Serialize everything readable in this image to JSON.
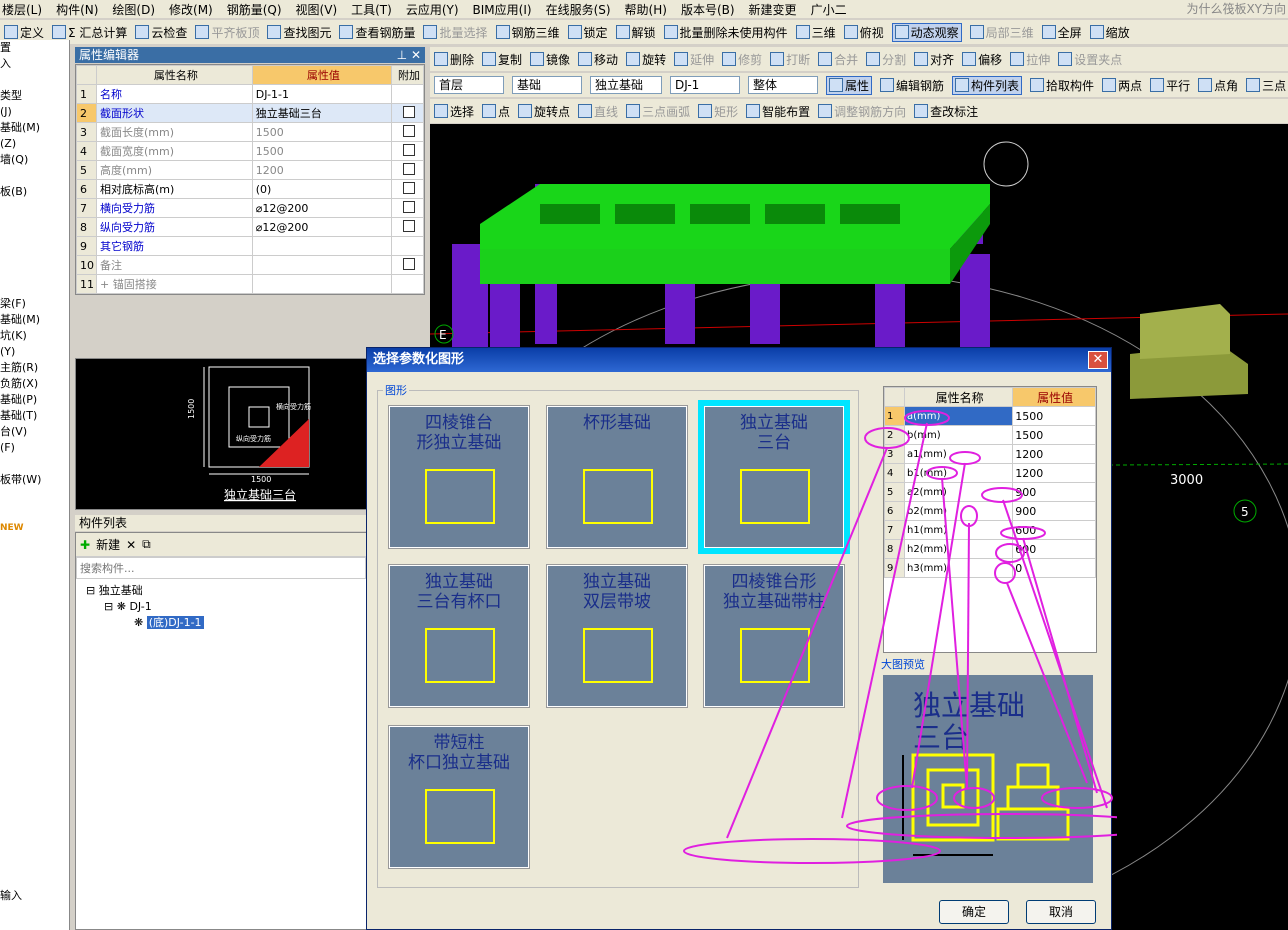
{
  "menu": {
    "items": [
      "楼层(L)",
      "构件(N)",
      "绘图(D)",
      "修改(M)",
      "钢筋量(Q)",
      "视图(V)",
      "工具(T)",
      "云应用(Y)",
      "BIM应用(I)",
      "在线服务(S)",
      "帮助(H)",
      "版本号(B)",
      "新建变更",
      "广小二"
    ],
    "right_text": "为什么筏板XY方向"
  },
  "toolbar1": {
    "items": [
      "定义",
      "Σ 汇总计算",
      "云检查",
      "平齐板顶",
      "查找图元",
      "查看钢筋量",
      "批量选择",
      "钢筋三维",
      "锁定",
      "解锁",
      "批量删除未使用构件",
      "三维",
      "俯视",
      "动态观察",
      "局部三维",
      "全屏",
      "缩放"
    ]
  },
  "toolbar2": {
    "items": [
      "删除",
      "复制",
      "镜像",
      "移动",
      "旋转",
      "延伸",
      "修剪",
      "打断",
      "合并",
      "分割",
      "对齐",
      "偏移",
      "拉伸",
      "设置夹点"
    ]
  },
  "toolbar3": {
    "combos": [
      "首层",
      "基础",
      "独立基础",
      "DJ-1",
      "整体"
    ],
    "buttons": [
      "属性",
      "编辑钢筋",
      "构件列表",
      "拾取构件",
      "两点",
      "平行",
      "点角",
      "三点"
    ]
  },
  "toolbar4": {
    "items": [
      "选择",
      "点",
      "旋转点",
      "直线",
      "三点画弧",
      "矩形",
      "智能布置",
      "调整钢筋方向",
      "查改标注"
    ]
  },
  "left_strip": {
    "items": [
      "置",
      "入",
      "",
      "类型",
      "(J)",
      "基础(M)",
      "(Z)",
      "墙(Q)",
      "",
      "板(B)",
      "",
      "",
      "",
      "",
      "",
      "",
      "梁(F)",
      "基础(M)",
      "坑(K)",
      "(Y)",
      "主筋(R)",
      "负筋(X)",
      "基础(P)",
      "基础(T)",
      "台(V)",
      "(F)",
      "",
      "板带(W)",
      "",
      "",
      "NEW",
      "",
      "",
      "",
      "",
      "",
      "",
      "",
      "",
      "",
      "",
      "",
      "",
      "",
      "",
      "",
      "",
      "",
      "",
      "",
      "",
      "",
      "",
      "输入"
    ]
  },
  "prop_editor": {
    "title": "属性编辑器",
    "headers": [
      "属性名称",
      "属性值",
      "附加"
    ],
    "rows": [
      {
        "no": "1",
        "name": "名称",
        "value": "DJ-1-1",
        "blue": true,
        "chk": false
      },
      {
        "no": "2",
        "name": "截面形状",
        "value": "独立基础三台",
        "blue": true,
        "chk": true
      },
      {
        "no": "3",
        "name": "截面长度(mm)",
        "value": "1500",
        "blue": false,
        "chk": true
      },
      {
        "no": "4",
        "name": "截面宽度(mm)",
        "value": "1500",
        "blue": false,
        "chk": true
      },
      {
        "no": "5",
        "name": "高度(mm)",
        "value": "1200",
        "blue": false,
        "chk": true
      },
      {
        "no": "6",
        "name": "相对底标高(m)",
        "value": "(0)",
        "blue": false,
        "chk": true
      },
      {
        "no": "7",
        "name": "横向受力筋",
        "value": "⌀12@200",
        "blue": true,
        "chk": true
      },
      {
        "no": "8",
        "name": "纵向受力筋",
        "value": "⌀12@200",
        "blue": true,
        "chk": true
      },
      {
        "no": "9",
        "name": "其它钢筋",
        "value": "",
        "blue": true,
        "chk": false
      },
      {
        "no": "10",
        "name": "备注",
        "value": "",
        "blue": false,
        "chk": true
      },
      {
        "no": "11",
        "name": "+ 锚固搭接",
        "value": "",
        "blue": false,
        "chk": false
      }
    ]
  },
  "preview": {
    "caption": "独立基础三台",
    "dim_bottom": "1500",
    "dim_side": "1500",
    "label1": "横向受力筋",
    "label2": "纵向受力筋"
  },
  "component_list": {
    "title": "构件列表",
    "new_label": "新建",
    "search_placeholder": "搜索构件...",
    "tree": [
      "独立基础",
      "DJ-1",
      "(底)DJ-1-1"
    ]
  },
  "viewport": {
    "labels": [
      "E",
      "3000",
      "5"
    ]
  },
  "dialog": {
    "title": "选择参数化图形",
    "group_label": "图形",
    "shapes": [
      {
        "caption": "四棱锥台\n形独立基础",
        "selected": false
      },
      {
        "caption": "杯形基础",
        "selected": false
      },
      {
        "caption": "独立基础\n三台",
        "selected": true
      },
      {
        "caption": "独立基础\n三台有杯口",
        "selected": false
      },
      {
        "caption": "独立基础\n双层带坡",
        "selected": false
      },
      {
        "caption": "四棱锥台形\n独立基础带柱",
        "selected": false
      },
      {
        "caption": "带短柱\n杯口独立基础",
        "selected": false
      }
    ],
    "param_headers": [
      "属性名称",
      "属性值"
    ],
    "params": [
      {
        "no": "1",
        "name": "a(mm)",
        "value": "1500"
      },
      {
        "no": "2",
        "name": "b(mm)",
        "value": "1500"
      },
      {
        "no": "3",
        "name": "a1(mm)",
        "value": "1200"
      },
      {
        "no": "4",
        "name": "b1(mm)",
        "value": "1200"
      },
      {
        "no": "5",
        "name": "a2(mm)",
        "value": "900"
      },
      {
        "no": "6",
        "name": "b2(mm)",
        "value": "900"
      },
      {
        "no": "7",
        "name": "h1(mm)",
        "value": "600"
      },
      {
        "no": "8",
        "name": "h2(mm)",
        "value": "600"
      },
      {
        "no": "9",
        "name": "h3(mm)",
        "value": "0"
      }
    ],
    "preview_label": "大图预览",
    "preview_caption": "独立基础\n三台",
    "ok": "确定",
    "cancel": "取消"
  }
}
